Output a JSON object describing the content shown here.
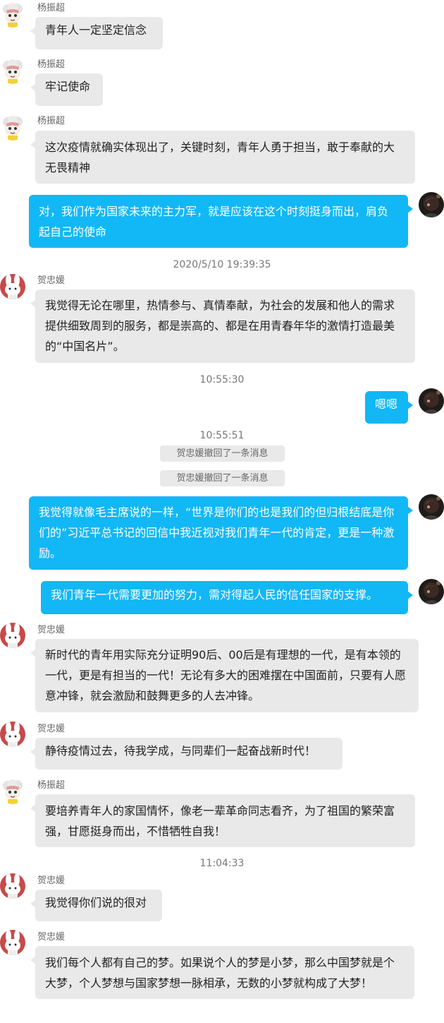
{
  "messages": [
    {
      "sender": "杨振超",
      "text": "青年人一定坚定信念"
    },
    {
      "sender": "杨振超",
      "text": "牢记使命"
    },
    {
      "sender": "杨振超",
      "text": "这次疫情就确实体现出了，关键时刻，青年人勇于担当，敢于奉献的大无畏精神"
    },
    {
      "text": "对，我们作为国家未来的主力军，就是应该在这个时刻挺身而出，肩负起自己的使命"
    },
    {
      "sender": "贺忠媛",
      "text": "我觉得无论在哪里，热情参与、真情奉献，为社会的发展和他人的需求提供细致周到的服务，都是崇高的、都是在用青春年华的激情打造最美的“中国名片”。"
    },
    {
      "text": "嗯嗯"
    },
    {
      "text": "我觉得就像毛主席说的一样，“世界是你们的也是我们的但归根结底是你们的”习近平总书记的回信中我近视对我们青年一代的肯定，更是一种激励。"
    },
    {
      "text": "我们青年一代需要更加的努力，需对得起人民的信任国家的支撑。"
    },
    {
      "sender": "贺忠媛",
      "text": "新时代的青年用实际充分证明90后、00后是有理想的一代，是有本领的一代，更是有担当的一代！无论有多大的困难摆在中国面前，只要有人愿意冲锋，就会激励和鼓舞更多的人去冲锋。"
    },
    {
      "sender": "贺忠媛",
      "text": "静待疫情过去，待我学成，与同辈们一起奋战新时代！"
    },
    {
      "sender": "杨振超",
      "text": "要培养青年人的家国情怀，像老一辈革命同志看齐，为了祖国的繁荣富强，甘愿挺身而出，不惜牺牲自我！"
    },
    {
      "sender": "贺忠媛",
      "text": "我觉得你们说的很对"
    },
    {
      "sender": "贺忠媛",
      "text": "我们每个人都有自己的梦。如果说个人的梦是小梦，那么中国梦就是个大梦，个人梦想与国家梦想一脉相承，无数的小梦就构成了大梦！"
    }
  ],
  "timestamps": [
    "2020/5/10 19:39:35",
    "10:55:30",
    "10:55:51",
    "11:04:33"
  ],
  "recall_notices": [
    "贺忠媛撤回了一条消息",
    "贺忠媛撤回了一条消息"
  ]
}
